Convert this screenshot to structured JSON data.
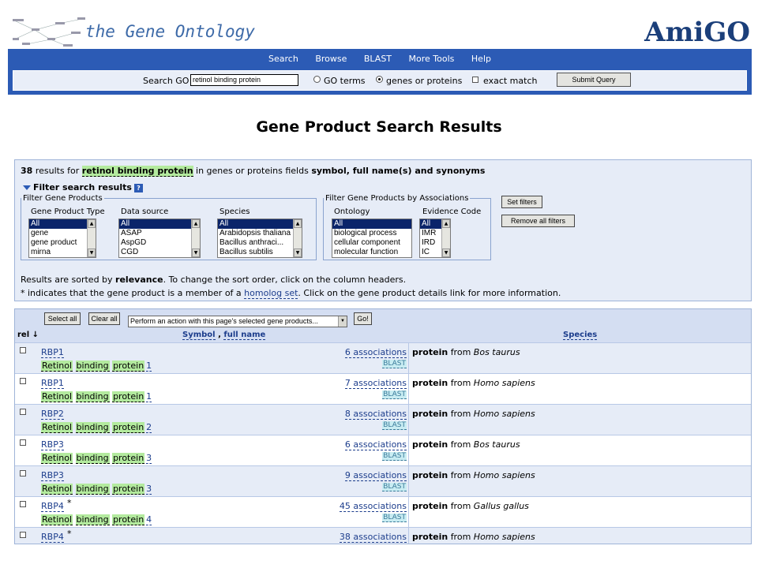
{
  "header": {
    "title": "the Gene Ontology",
    "logo": "AmiGO"
  },
  "nav": {
    "items": [
      "Search",
      "Browse",
      "BLAST",
      "More Tools",
      "Help"
    ]
  },
  "searchbar": {
    "label": "Search GO",
    "value": "retinol binding protein",
    "opt_go_terms": "GO terms",
    "opt_genes": "genes or proteins",
    "opt_exact": "exact match",
    "selected": "genes or proteins",
    "submit": "Submit Query"
  },
  "page_title": "Gene Product Search Results",
  "summary": {
    "count": "38",
    "results_for": "results for",
    "query": "retinol binding protein",
    "fields_prefix": "in genes or proteins fields",
    "fields": "symbol, full name(s) and synonyms"
  },
  "filters": {
    "toggle_label": "Filter search results",
    "help": "?",
    "group1_legend": "Filter Gene Products",
    "group2_legend": "Filter Gene Products by Associations",
    "gene_product_type": {
      "label": "Gene Product Type",
      "options": [
        "All",
        "gene",
        "gene product",
        "mirna"
      ]
    },
    "data_source": {
      "label": "Data source",
      "options": [
        "All",
        "ASAP",
        "AspGD",
        "CGD"
      ]
    },
    "species": {
      "label": "Species",
      "options": [
        "All",
        "Arabidopsis thaliana",
        "Bacillus anthraci...",
        "Bacillus subtilis"
      ]
    },
    "ontology": {
      "label": "Ontology",
      "options": [
        "All",
        "biological process",
        "cellular component",
        "molecular function"
      ]
    },
    "evidence_code": {
      "label": "Evidence Code",
      "options": [
        "All",
        "IMR",
        "IRD",
        "IC"
      ]
    },
    "set_filters": "Set filters",
    "remove_filters": "Remove all filters"
  },
  "notes": {
    "sort_pre": "Results are sorted by",
    "sort_bold": "relevance",
    "sort_post": ". To change the sort order, click on the column headers.",
    "homolog_pre": "* indicates that the gene product is a member of a",
    "homolog_link": "homolog set",
    "homolog_post": ". Click on the gene product details link for more information."
  },
  "table": {
    "select_all": "Select all",
    "clear_all": "Clear all",
    "action": "Perform an action with this page's selected gene products...",
    "go": "Go!",
    "col_rel": "rel ↓",
    "col_symbol": "Symbol",
    "col_sep": ",",
    "col_fullname": "full name",
    "col_species": "Species",
    "word1": "Retinol",
    "word2": "binding",
    "word3": "protein",
    "blast": "BLAST",
    "type_word": "protein",
    "from_word": "from",
    "rows": [
      {
        "symbol": "RBP1",
        "star": "",
        "num": "1",
        "assoc": "6 associations",
        "species": "Bos taurus"
      },
      {
        "symbol": "RBP1",
        "star": "",
        "num": "1",
        "assoc": "7 associations",
        "species": "Homo sapiens"
      },
      {
        "symbol": "RBP2",
        "star": "",
        "num": "2",
        "assoc": "8 associations",
        "species": "Homo sapiens"
      },
      {
        "symbol": "RBP3",
        "star": "",
        "num": "3",
        "assoc": "6 associations",
        "species": "Bos taurus"
      },
      {
        "symbol": "RBP3",
        "star": "",
        "num": "3",
        "assoc": "9 associations",
        "species": "Homo sapiens"
      },
      {
        "symbol": "RBP4",
        "star": "*",
        "num": "4",
        "assoc": "45 associations",
        "species": "Gallus gallus"
      },
      {
        "symbol": "RBP4",
        "star": "*",
        "num": "4",
        "assoc": "38 associations",
        "species": "Homo sapiens"
      }
    ]
  },
  "colors": {
    "nav_blue": "#2c5bb5",
    "panel_bg": "#e6ecf7",
    "highlight_green": "#b3ea9e",
    "blast_bg": "#c8ecf2"
  }
}
